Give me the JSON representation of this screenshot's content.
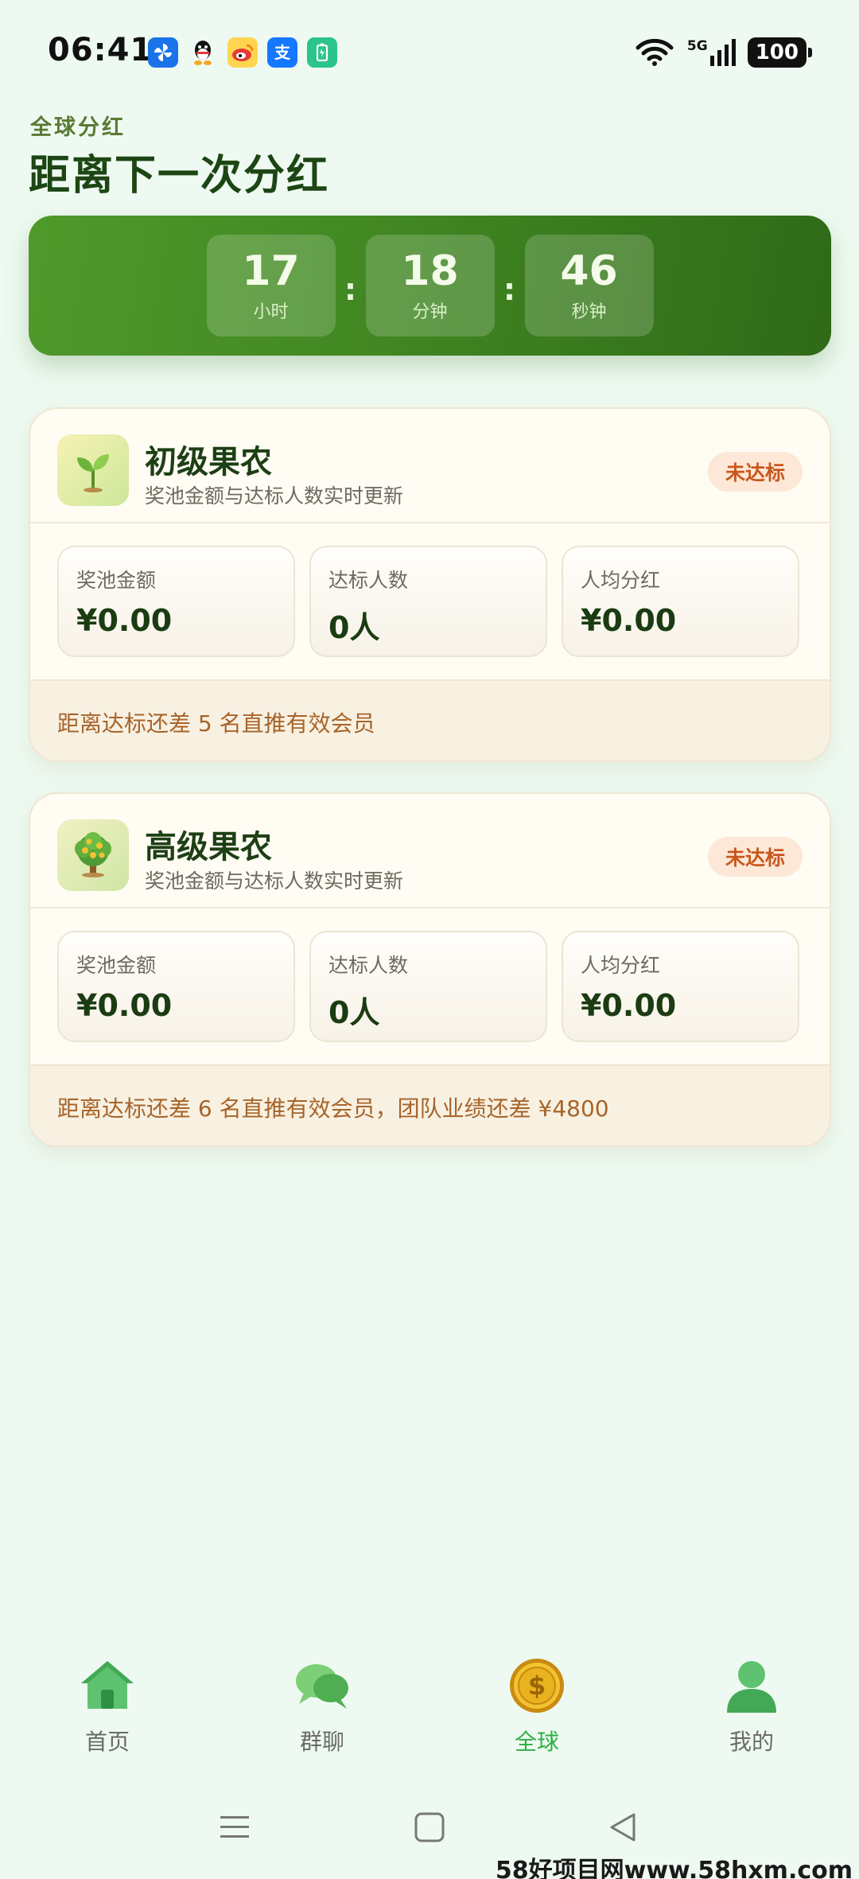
{
  "status_bar": {
    "time": "06:41",
    "network": "5G",
    "battery": "100",
    "notification_icons": [
      "pinwheel-app-icon",
      "qq-icon",
      "weibo-icon",
      "alipay-icon",
      "battery-saver-app-icon"
    ]
  },
  "header": {
    "subtitle": "全球分红",
    "title": "距离下一次分红"
  },
  "countdown": {
    "hours": "17",
    "hours_unit": "小时",
    "minutes": "18",
    "minutes_unit": "分钟",
    "seconds": "46",
    "seconds_unit": "秒钟",
    "separator": ":"
  },
  "tiers": [
    {
      "name": "初级果农",
      "description": "奖池金额与达标人数实时更新",
      "badge": "未达标",
      "icon": "sprout-icon",
      "stats": [
        {
          "label": "奖池金额",
          "value": "¥0.00"
        },
        {
          "label": "达标人数",
          "value": "0人"
        },
        {
          "label": "人均分红",
          "value": "¥0.00"
        }
      ],
      "footer": "距离达标还差 5 名直推有效会员"
    },
    {
      "name": "高级果农",
      "description": "奖池金额与达标人数实时更新",
      "badge": "未达标",
      "icon": "money-tree-icon",
      "stats": [
        {
          "label": "奖池金额",
          "value": "¥0.00"
        },
        {
          "label": "达标人数",
          "value": "0人"
        },
        {
          "label": "人均分红",
          "value": "¥0.00"
        }
      ],
      "footer": "距离达标还差 6 名直推有效会员，团队业绩还差 ¥4800"
    }
  ],
  "bottom_nav": [
    {
      "label": "首页",
      "icon": "home-icon",
      "active": false
    },
    {
      "label": "群聊",
      "icon": "chat-icon",
      "active": false
    },
    {
      "label": "全球",
      "icon": "coin-icon",
      "active": true
    },
    {
      "label": "我的",
      "icon": "user-icon",
      "active": false
    }
  ],
  "colors": {
    "background": "#eefaf1",
    "countdown_green": "#3f8421",
    "title_green": "#1c4614",
    "badge_text": "#c9571d",
    "footer_text": "#a7642a",
    "nav_active": "#2fae45"
  },
  "watermark": "58好项目网www.58hxm.com"
}
